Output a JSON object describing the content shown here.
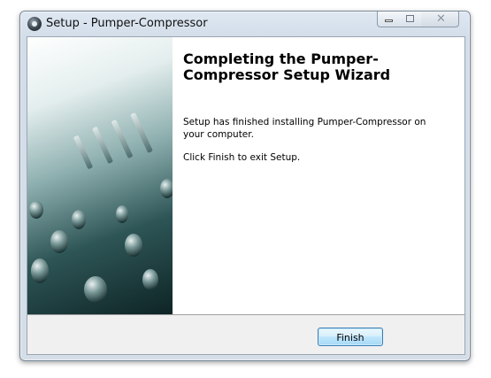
{
  "window": {
    "title": "Setup - Pumper-Compressor",
    "controls": {
      "minimize_icon": "minimize-icon",
      "maximize_icon": "maximize-icon",
      "close_icon": "close-icon",
      "close_glyph": "✕"
    },
    "app_icon": "app-icon"
  },
  "wizard": {
    "heading": "Completing the Pumper-Compressor Setup Wizard",
    "message": "Setup has finished installing Pumper-Compressor on your computer.",
    "instruction": "Click Finish to exit Setup.",
    "side_image": "mixing-console-image"
  },
  "buttons": {
    "finish_label": "Finish"
  },
  "colors": {
    "button_border": "#3c7fb1",
    "panel_background": "#ffffff",
    "footer_background": "#f0f0f0"
  }
}
